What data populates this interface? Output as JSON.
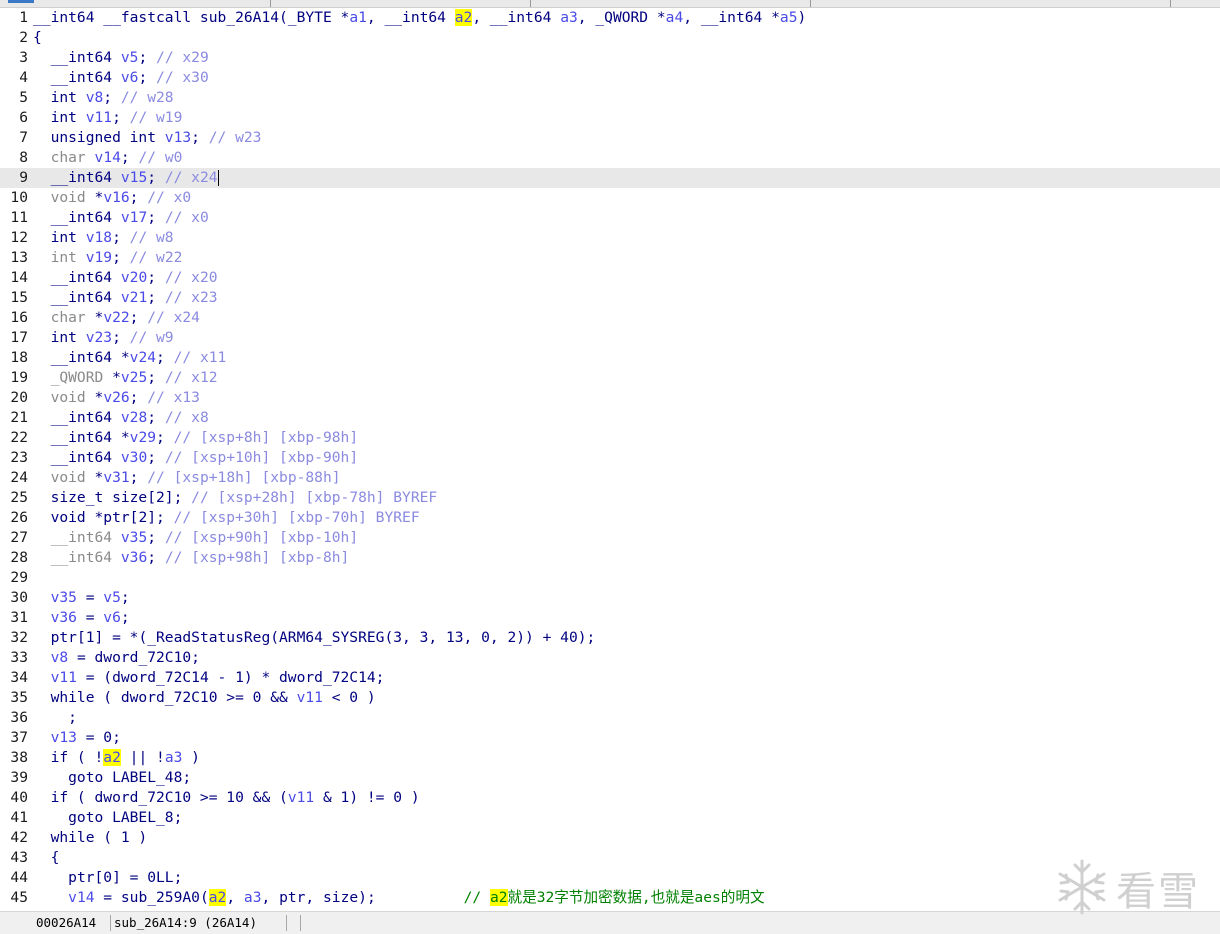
{
  "window": {
    "top_strip_label": ""
  },
  "code_lines": [
    "__int64 __fastcall sub_26A14(_BYTE *a1, __int64 a2, __int64 a3, _QWORD *a4, __int64 *a5)",
    "{",
    "  __int64 v5; // x29",
    "  __int64 v6; // x30",
    "  int v8; // w28",
    "  int v11; // w19",
    "  unsigned int v13; // w23",
    "  char v14; // w0",
    "  __int64 v15; // x24",
    "  void *v16; // x0",
    "  __int64 v17; // x0",
    "  int v18; // w8",
    "  int v19; // w22",
    "  __int64 v20; // x20",
    "  __int64 v21; // x23",
    "  char *v22; // x24",
    "  int v23; // w9",
    "  __int64 *v24; // x11",
    "  _QWORD *v25; // x12",
    "  void *v26; // x13",
    "  __int64 v28; // x8",
    "  __int64 *v29; // [xsp+8h] [xbp-98h]",
    "  __int64 v30; // [xsp+10h] [xbp-90h]",
    "  void *v31; // [xsp+18h] [xbp-88h]",
    "  size_t size[2]; // [xsp+28h] [xbp-78h] BYREF",
    "  void *ptr[2]; // [xsp+30h] [xbp-70h] BYREF",
    "  __int64 v35; // [xsp+90h] [xbp-10h]",
    "  __int64 v36; // [xsp+98h] [xbp-8h]",
    "",
    "  v35 = v5;",
    "  v36 = v6;",
    "  ptr[1] = *(_ReadStatusReg(ARM64_SYSREG(3, 3, 13, 0, 2)) + 40);",
    "  v8 = dword_72C10;",
    "  v11 = (dword_72C14 - 1) * dword_72C14;",
    "  while ( dword_72C10 >= 0 && v11 < 0 )",
    "    ;",
    "  v13 = 0;",
    "  if ( !a2 || !a3 )",
    "    goto LABEL_48;",
    "  if ( dword_72C10 >= 10 && (v11 & 1) != 0 )",
    "    goto LABEL_8;",
    "  while ( 1 )",
    "  {",
    "    ptr[0] = 0LL;",
    "    v14 = sub_259A0(a2, a3, ptr, size);          // a2就是32字节加密数据,也就是aes的明文"
  ],
  "current_line": 9,
  "status_bar": {
    "address": "00026A14",
    "location": "sub_26A14:9 (26A14)"
  },
  "watermark": {
    "text": "看雪"
  }
}
